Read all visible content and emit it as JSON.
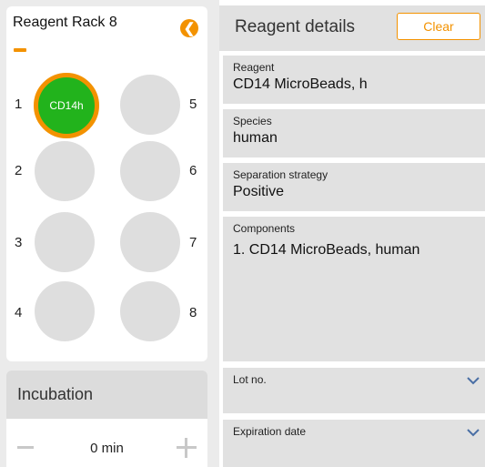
{
  "rack": {
    "title": "Reagent Rack 8",
    "slots": [
      {
        "number": "1",
        "label": "CD14h",
        "filled": true
      },
      {
        "number": "2",
        "label": "",
        "filled": false
      },
      {
        "number": "3",
        "label": "",
        "filled": false
      },
      {
        "number": "4",
        "label": "",
        "filled": false
      },
      {
        "number": "5",
        "label": "",
        "filled": false
      },
      {
        "number": "6",
        "label": "",
        "filled": false
      },
      {
        "number": "7",
        "label": "",
        "filled": false
      },
      {
        "number": "8",
        "label": "",
        "filled": false
      }
    ]
  },
  "incubation": {
    "title": "Incubation",
    "value": "0 min"
  },
  "details": {
    "title": "Reagent details",
    "clear_label": "Clear",
    "reagent": {
      "label": "Reagent",
      "value": "CD14 MicroBeads, h"
    },
    "species": {
      "label": "Species",
      "value": "human"
    },
    "strategy": {
      "label": "Separation strategy",
      "value": "Positive"
    },
    "components": {
      "label": "Components",
      "value": "1. CD14 MicroBeads, human"
    },
    "lot": {
      "label": "Lot no.",
      "value": ""
    },
    "expiration": {
      "label": "Expiration date",
      "value": ""
    }
  },
  "colors": {
    "accent": "#f39200",
    "filled_slot": "#22b31c",
    "empty_slot": "#dedede",
    "panel_gray": "#e1e1e1"
  },
  "icons": {
    "back": "arrow-left-circle-icon",
    "dropdown": "chevron-down-icon",
    "minus": "minus-icon",
    "plus": "plus-icon"
  }
}
